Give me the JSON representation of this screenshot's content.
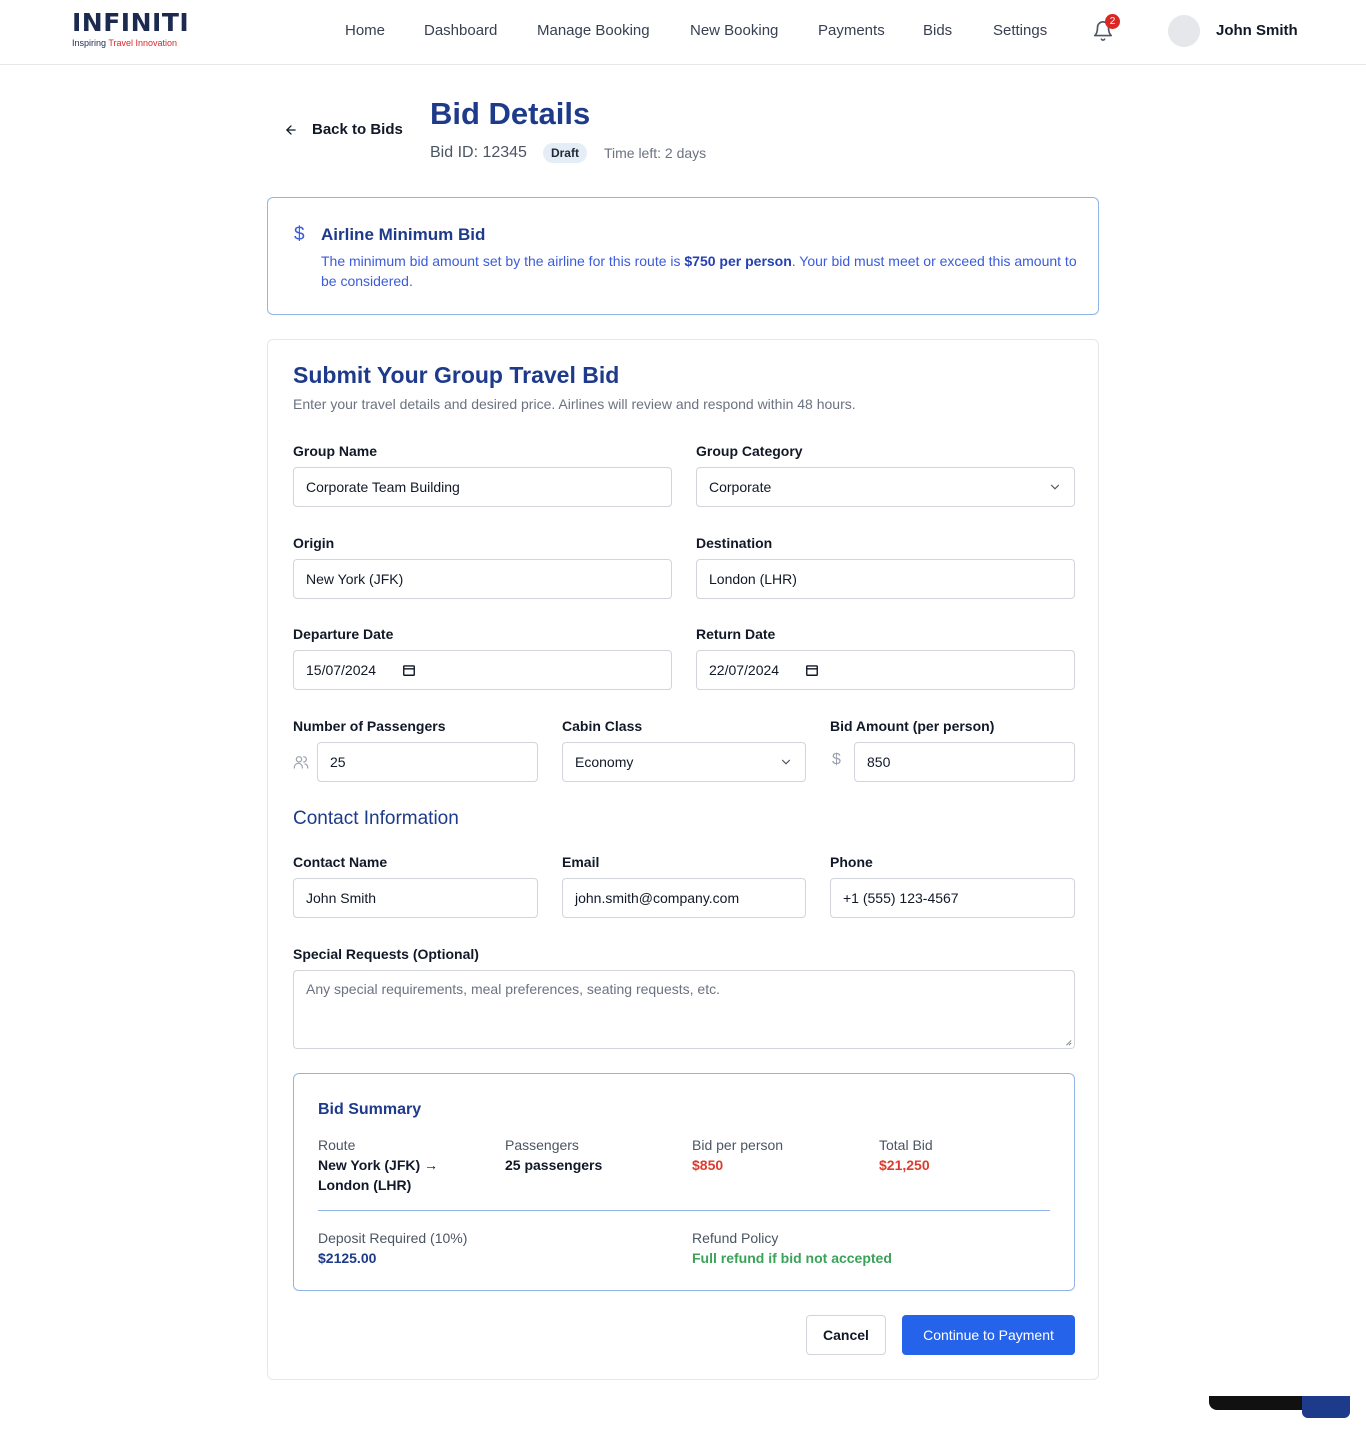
{
  "brand": {
    "logo_word": "INFINITI",
    "tagline_a": "Inspiring ",
    "tagline_b": "Travel Innovation"
  },
  "nav": [
    {
      "label": "Home"
    },
    {
      "label": "Dashboard"
    },
    {
      "label": "Manage Booking"
    },
    {
      "label": "New Booking"
    },
    {
      "label": "Payments"
    },
    {
      "label": "Bids"
    },
    {
      "label": "Settings"
    }
  ],
  "notifications": {
    "count": "2",
    "icon": "bell-icon"
  },
  "user": {
    "name": "John Smith"
  },
  "header": {
    "back_label": "Back to Bids",
    "title": "Bid Details",
    "bid_id": "Bid ID: 12345",
    "status": "Draft",
    "time_left": "Time left: 2 days"
  },
  "min_bid": {
    "title": "Airline Minimum Bid",
    "text_before": "The minimum bid amount set by the airline for this route is ",
    "amount": "$750 per person",
    "text_after": ". Your bid must meet or exceed this amount to be considered."
  },
  "form": {
    "title": "Submit Your Group Travel Bid",
    "subtitle": "Enter your travel details and desired price. Airlines will review and respond within 48 hours.",
    "group_name": {
      "label": "Group Name",
      "value": "Corporate Team Building"
    },
    "group_category": {
      "label": "Group Category",
      "value": "Corporate"
    },
    "origin": {
      "label": "Origin",
      "value": "New York (JFK)"
    },
    "destination": {
      "label": "Destination",
      "value": "London (LHR)"
    },
    "departure": {
      "label": "Departure Date",
      "value": "15/07/2024"
    },
    "return": {
      "label": "Return Date",
      "value": "22/07/2024"
    },
    "passengers": {
      "label": "Number of Passengers",
      "value": "25"
    },
    "cabin": {
      "label": "Cabin Class",
      "value": "Economy"
    },
    "bid_amount": {
      "label": "Bid Amount (per person)",
      "value": "850"
    },
    "contact_section": "Contact Information",
    "contact_name": {
      "label": "Contact Name",
      "value": "John Smith"
    },
    "email": {
      "label": "Email",
      "value": "john.smith@company.com"
    },
    "phone": {
      "label": "Phone",
      "value": "+1 (555) 123-4567"
    },
    "special": {
      "label": "Special Requests (Optional)",
      "placeholder": "Any special requirements, meal preferences, seating requests, etc."
    }
  },
  "summary": {
    "title": "Bid Summary",
    "route_label": "Route",
    "route_line1": "New York (JFK) →",
    "route_line2": "London (LHR)",
    "passengers_label": "Passengers",
    "passengers_value": "25 passengers",
    "per_person_label": "Bid per person",
    "per_person_value": "$850",
    "total_label": "Total Bid",
    "total_value": "$21,250",
    "deposit_label": "Deposit Required (10%)",
    "deposit_value": "$2125.00",
    "refund_label": "Refund Policy",
    "refund_value": "Full refund if bid not accepted"
  },
  "actions": {
    "cancel": "Cancel",
    "continue": "Continue to Payment"
  },
  "colors": {
    "primary": "#1e3a8a",
    "accent": "#2563eb",
    "price": "#dc3c2d",
    "success": "#3aa35a",
    "badge": "#dc2626"
  }
}
